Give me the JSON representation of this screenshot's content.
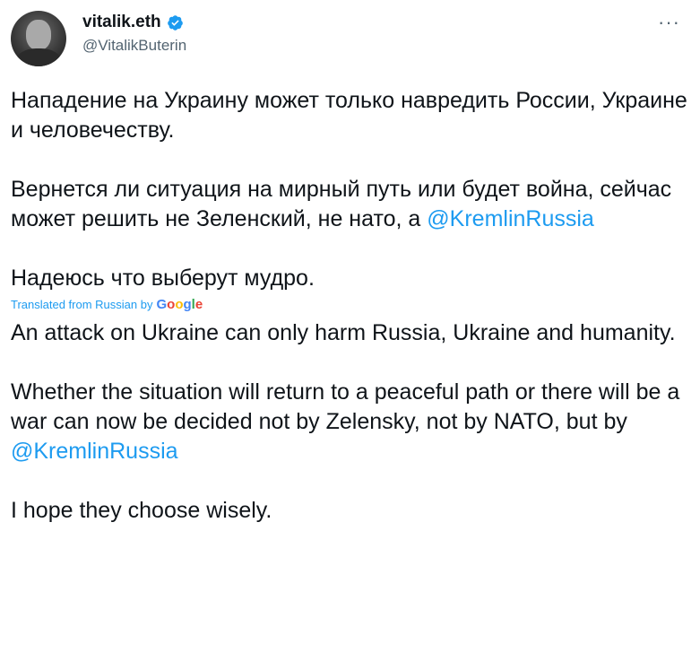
{
  "author": {
    "display_name": "vitalik.eth",
    "handle": "@VitalikButerin",
    "verified": true
  },
  "icons": {
    "verified": "verified-badge-icon",
    "more": "more-options-icon",
    "avatar": "avatar"
  },
  "tweet": {
    "original": {
      "p1": "Нападение на Украину может только навредить России, Украине и человечеству.",
      "p2_text": "Вернется ли ситуация на мирный путь или будет война, сейчас может решить не Зеленский, не нато, а ",
      "p2_mention": "@KremlinRussia",
      "p3": "Надеюсь что выберут мудро."
    },
    "translation_note": {
      "prefix": "Translated from Russian by",
      "provider": "Google"
    },
    "translated": {
      "p1": "An attack on Ukraine can only harm Russia, Ukraine and humanity.",
      "p2_text": " Whether the situation will return to a peaceful path or there will be a war can now be decided not by Zelensky, not by NATO, but by ",
      "p2_mention": "@KremlinRussia",
      "p3": " I hope they choose wisely."
    }
  },
  "colors": {
    "link": "#1d9bf0",
    "text": "#0f1419",
    "secondary": "#536471"
  }
}
